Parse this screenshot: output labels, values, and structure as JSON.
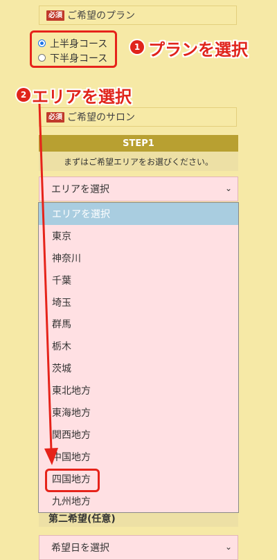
{
  "plan": {
    "badge": "必須",
    "label": "ご希望のプラン",
    "options": [
      {
        "label": "上半身コース",
        "checked": true
      },
      {
        "label": "下半身コース",
        "checked": false
      }
    ]
  },
  "annotations": {
    "step1": {
      "number": "1",
      "text": "プランを選択"
    },
    "step2": {
      "number": "2",
      "text": "エリアを選択"
    },
    "color": "#e0241b"
  },
  "salon": {
    "badge": "必須",
    "label": "ご希望のサロン",
    "step_title": "STEP1",
    "step_subtitle": "まずはご希望エリアをお選びください。",
    "area_select_value": "エリアを選択",
    "area_options": [
      "エリアを選択",
      "東京",
      "神奈川",
      "千葉",
      "埼玉",
      "群馬",
      "栃木",
      "茨城",
      "東北地方",
      "東海地方",
      "関西地方",
      "中国地方",
      "四国地方",
      "九州地方"
    ],
    "highlighted_option": "四国地方"
  },
  "second_choice": {
    "label": "第二希望(任意)",
    "date_select_value": "希望日を選択"
  },
  "icons": {
    "dropdown": "chevron-down-icon",
    "arrow": "red-arrow-icon"
  }
}
